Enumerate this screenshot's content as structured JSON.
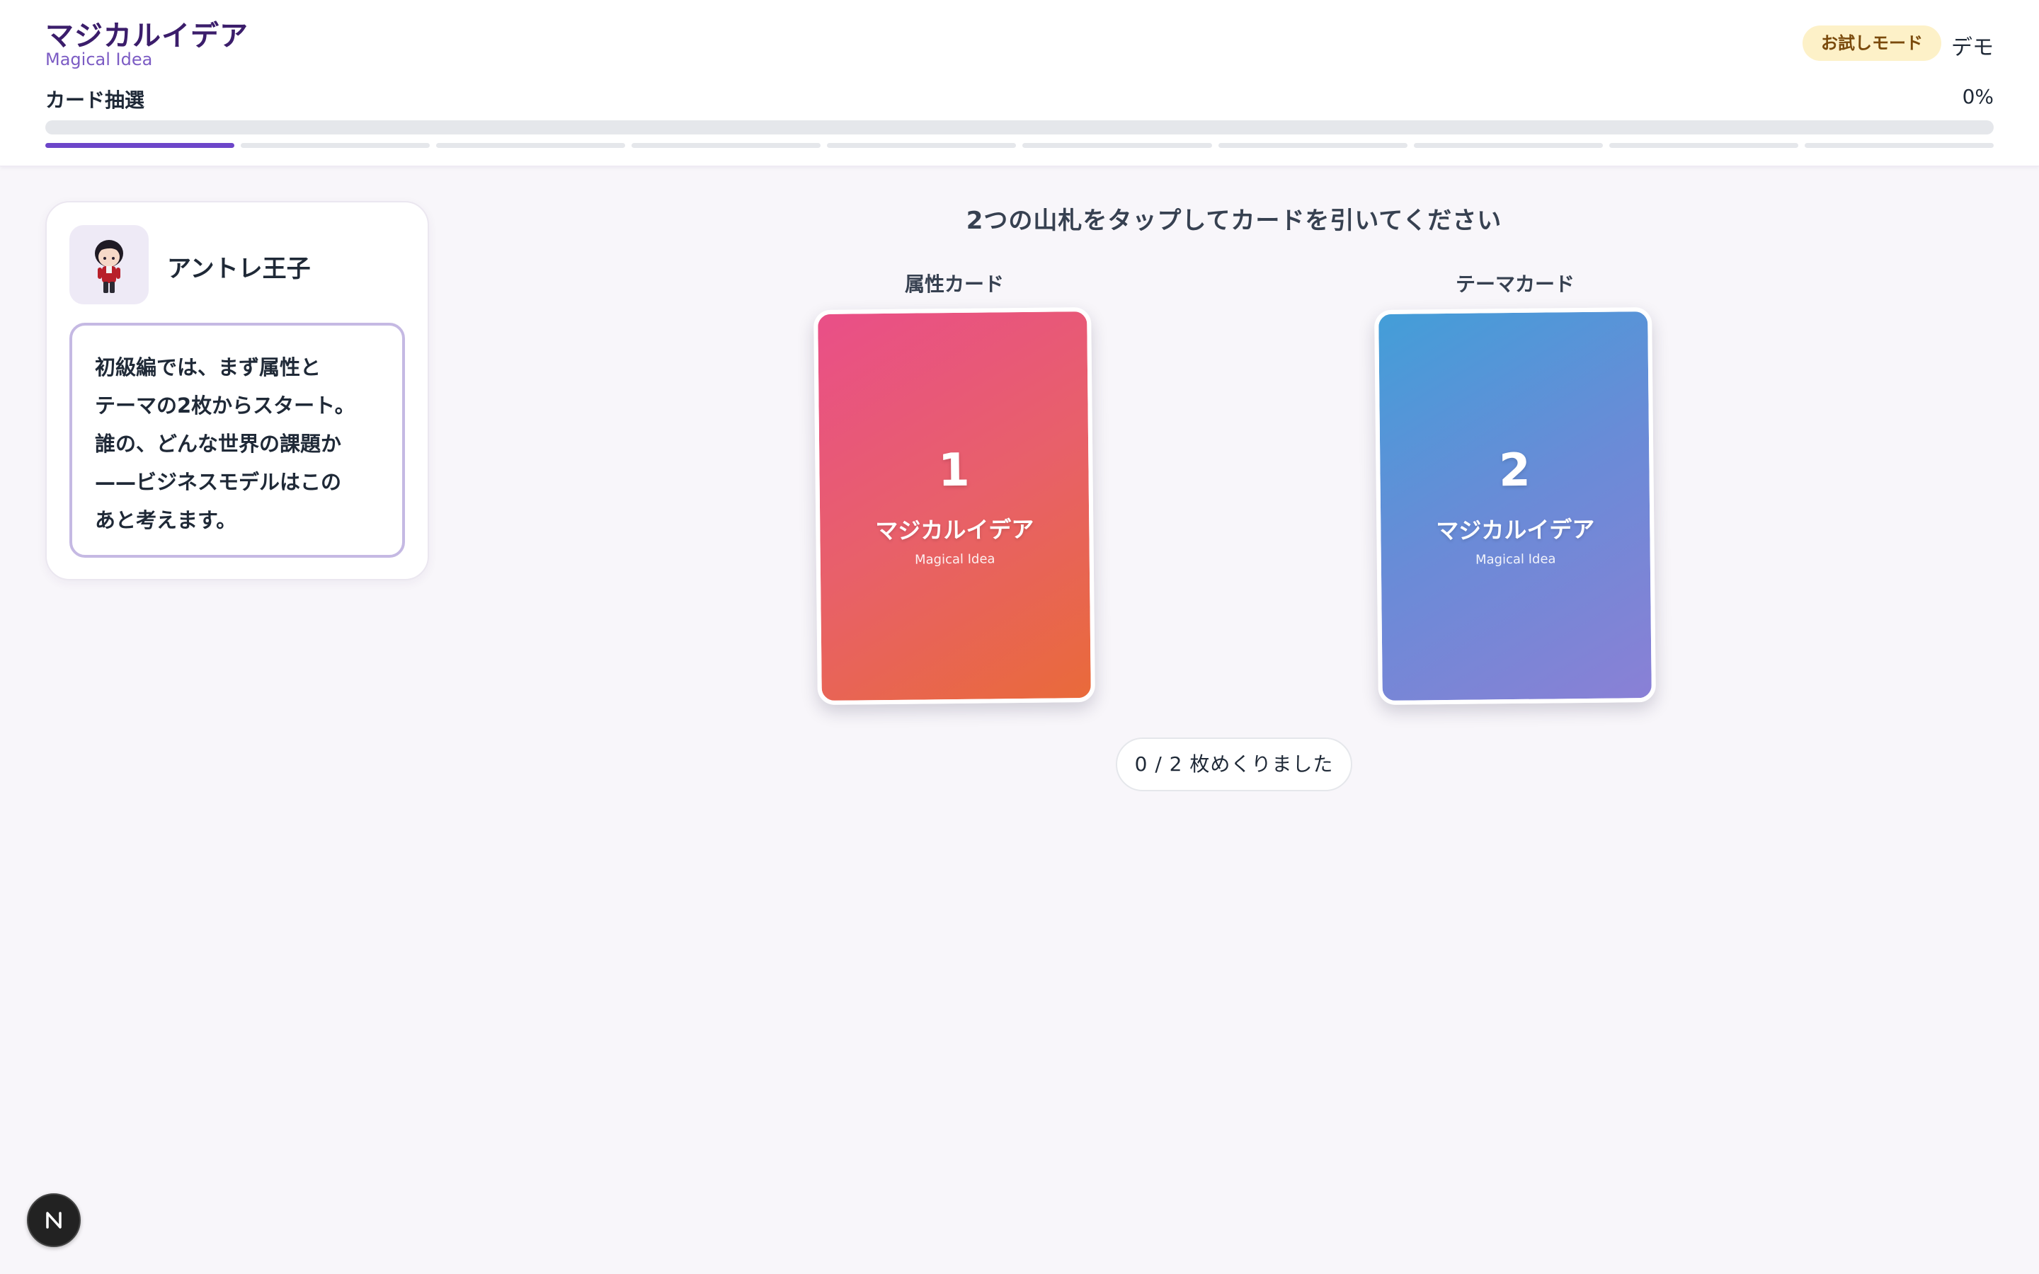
{
  "header": {
    "app_title": "マジカルイデア",
    "app_subtitle": "Magical Idea",
    "mode_badge": "お試しモード",
    "demo_label": "デモ",
    "step_label": "カード抽選",
    "progress_percent": "0%",
    "progress_value": 0,
    "steps_total": 10,
    "steps_active": 1,
    "colors": {
      "accent": "#6d46c9",
      "badge_bg": "#fdf1c8"
    }
  },
  "guide": {
    "avatar_icon": "character-avatar-icon",
    "name": "アントレ王子",
    "message": "初級編では、まず属性と\nテーマの2枚からスタート。\n誰の、どんな世界の課題か\n——ビジネスモデルはこの\nあと考えます。"
  },
  "draw": {
    "instruction": "2つの山札をタップしてカードを引いてください",
    "decks": [
      {
        "label": "属性カード",
        "number": "1",
        "title": "マジカルイデア",
        "subtitle": "Magical Idea",
        "colors": [
          "#e94f88",
          "#e96a3a"
        ]
      },
      {
        "label": "テーマカード",
        "number": "2",
        "title": "マジカルイデア",
        "subtitle": "Magical Idea",
        "colors": [
          "#439ed8",
          "#8a80d6"
        ]
      }
    ],
    "counter": "0 / 2 枚めくりました"
  },
  "floating": {
    "badge_icon": "n-logo-icon"
  }
}
